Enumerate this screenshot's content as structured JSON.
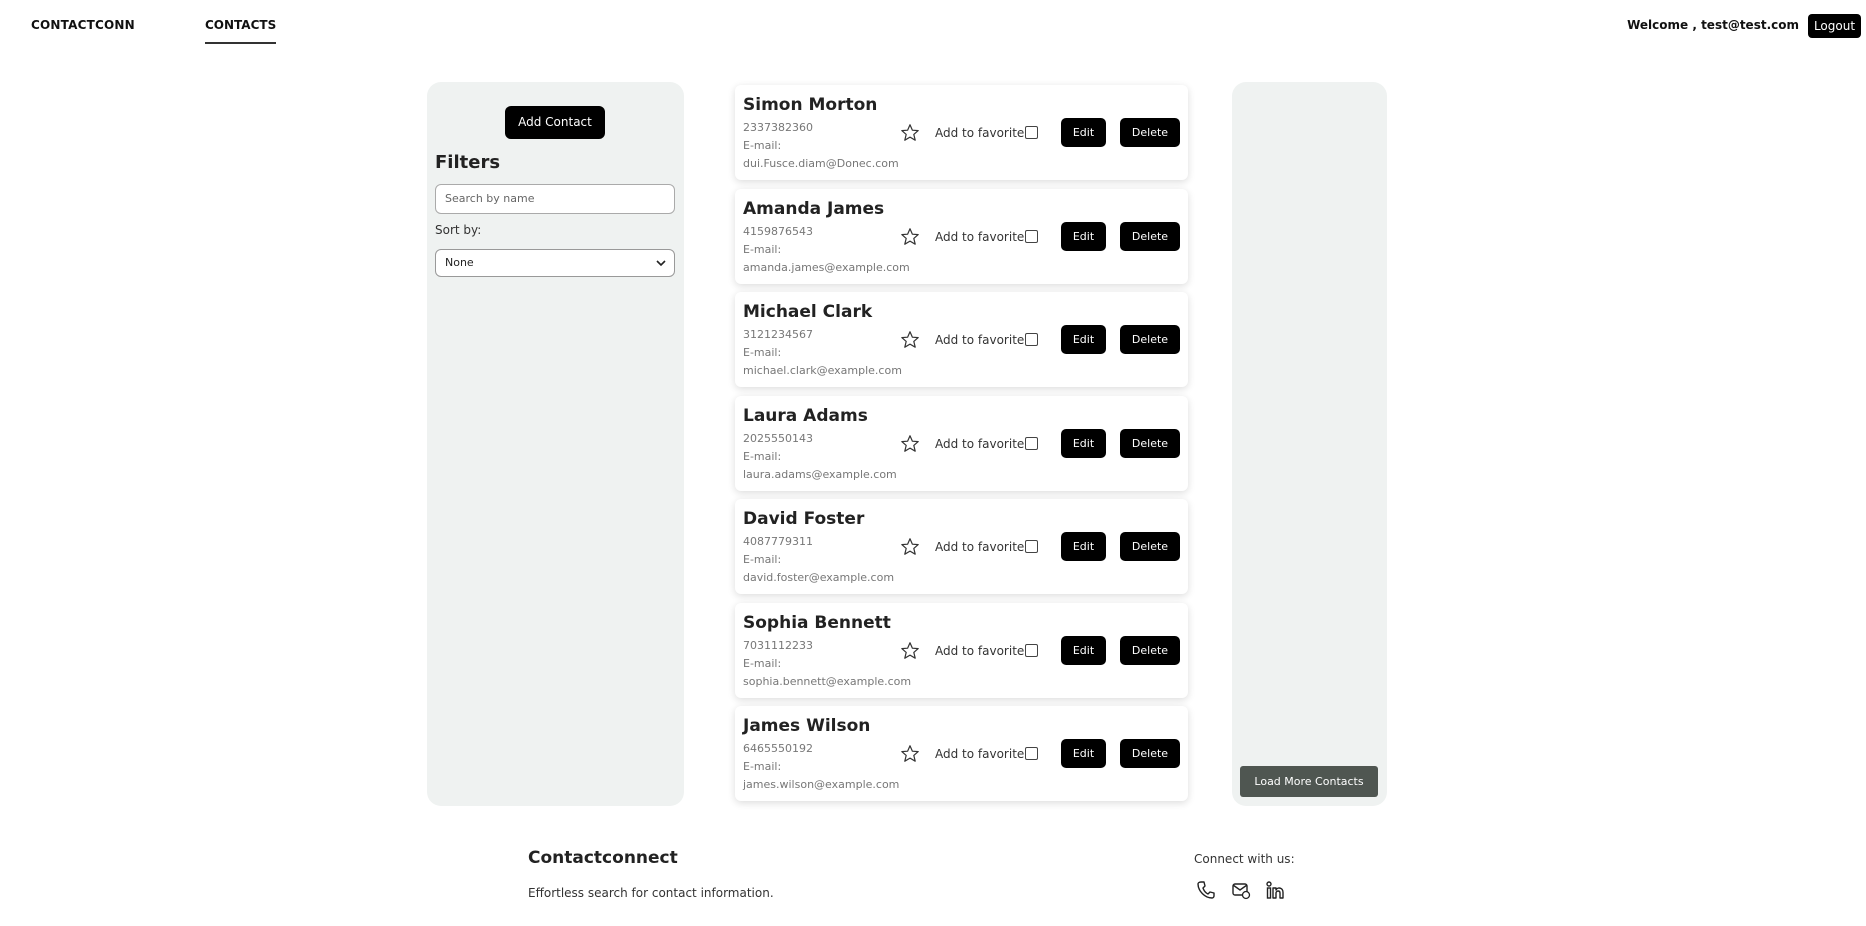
{
  "nav": {
    "brand": "CONTACTCONN",
    "tab": "CONTACTS",
    "welcome": "Welcome , test@test.com",
    "logout": "Logout"
  },
  "filters": {
    "add_contact": "Add Contact",
    "title": "Filters",
    "search_placeholder": "Search by name",
    "sort_label": "Sort by:",
    "sort_value": "None"
  },
  "contacts": [
    {
      "name": "Simon Morton",
      "phone": "2337382360",
      "email_label": "E-mail:",
      "email": "dui.Fusce.diam@Donec.com"
    },
    {
      "name": "Amanda James",
      "phone": "4159876543",
      "email_label": "E-mail:",
      "email": "amanda.james@example.com"
    },
    {
      "name": "Michael Clark",
      "phone": "3121234567",
      "email_label": "E-mail:",
      "email": "michael.clark@example.com"
    },
    {
      "name": "Laura Adams",
      "phone": "2025550143",
      "email_label": "E-mail:",
      "email": "laura.adams@example.com"
    },
    {
      "name": "David Foster",
      "phone": "4087779311",
      "email_label": "E-mail:",
      "email": "david.foster@example.com"
    },
    {
      "name": "Sophia Bennett",
      "phone": "7031112233",
      "email_label": "E-mail:",
      "email": "sophia.bennett@example.com"
    },
    {
      "name": "James Wilson",
      "phone": "6465550192",
      "email_label": "E-mail:",
      "email": "james.wilson@example.com"
    }
  ],
  "card_labels": {
    "favorite": "Add to favorite",
    "edit": "Edit",
    "delete": "Delete",
    "star_icon": "star-icon"
  },
  "right_panel": {
    "load_more": "Load More Contacts"
  },
  "footer": {
    "title": "Contactconnect",
    "tagline": "Effortless search for contact information.",
    "connect": "Connect with us:",
    "icons": [
      "phone-icon",
      "mail-icon",
      "linkedin-icon"
    ]
  },
  "colors": {
    "panel_bg": "#eff2f1",
    "button_bg": "#000000",
    "load_more_bg": "#4f5651"
  }
}
